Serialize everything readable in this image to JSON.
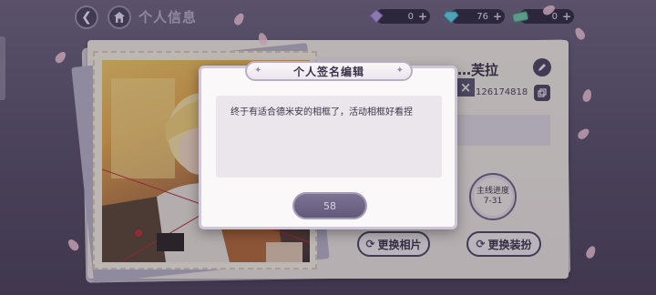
{
  "header": {
    "title": "个人信息",
    "currencies": [
      {
        "icon": "gem-purple-icon",
        "value": "0",
        "color": "#b59be0"
      },
      {
        "icon": "diamond-blue-icon",
        "value": "76",
        "color": "#5fd6e6"
      },
      {
        "icon": "ticket-green-icon",
        "value": "0",
        "color": "#6fc9a8"
      }
    ]
  },
  "profile": {
    "name": "…芙拉",
    "id": "126174818",
    "progress_label": "主线进度",
    "progress_value": "7-31",
    "change_photo_label": "更换相片",
    "change_outfit_label": "更换装扮"
  },
  "dialog": {
    "title": "个人签名编辑",
    "signature_text": "终于有适合德米安的相框了，活动相框好看捏",
    "confirm_label": "58"
  },
  "colors": {
    "accent": "#4c4660",
    "dialog_bg": "#fbf8f9",
    "input_bg": "#ebe6ec",
    "button": "#6d6485"
  }
}
